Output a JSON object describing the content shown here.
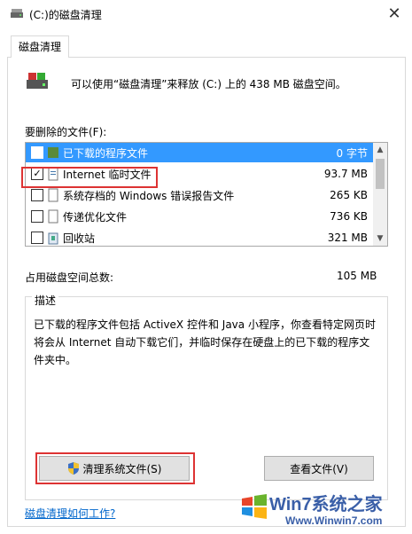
{
  "window": {
    "title": "(C:)的磁盘清理",
    "close": "✕"
  },
  "tabs": [
    {
      "label": "磁盘清理"
    }
  ],
  "summary": "可以使用“磁盘清理”来释放  (C:) 上的 438 MB 磁盘空间。",
  "files_label": "要删除的文件(F):",
  "files": [
    {
      "name": "已下载的程序文件",
      "size": "0 字节",
      "checked": true,
      "selected": true
    },
    {
      "name": "Internet 临时文件",
      "size": "93.7 MB",
      "checked": true,
      "selected": false
    },
    {
      "name": "系统存档的 Windows 错误报告文件",
      "size": "265 KB",
      "checked": false,
      "selected": false
    },
    {
      "name": "传递优化文件",
      "size": "736 KB",
      "checked": false,
      "selected": false
    },
    {
      "name": "回收站",
      "size": "321 MB",
      "checked": false,
      "selected": false
    }
  ],
  "total": {
    "label": "占用磁盘空间总数:",
    "value": "105 MB"
  },
  "description": {
    "title": "描述",
    "text": "已下载的程序文件包括 ActiveX 控件和 Java 小程序，你查看特定网页时将会从 Internet 自动下载它们，并临时保存在硬盘上的已下载的程序文件夹中。"
  },
  "buttons": {
    "cleanup_system": "清理系统文件(S)",
    "view_files": "查看文件(V)"
  },
  "help_link": "磁盘清理如何工作?",
  "watermark": {
    "line1": "Win7系统之家",
    "line2": "Www.Winwin7.com"
  },
  "colors": {
    "selection": "#3399ff",
    "highlight_box": "#dd3333",
    "link": "#0066cc"
  }
}
